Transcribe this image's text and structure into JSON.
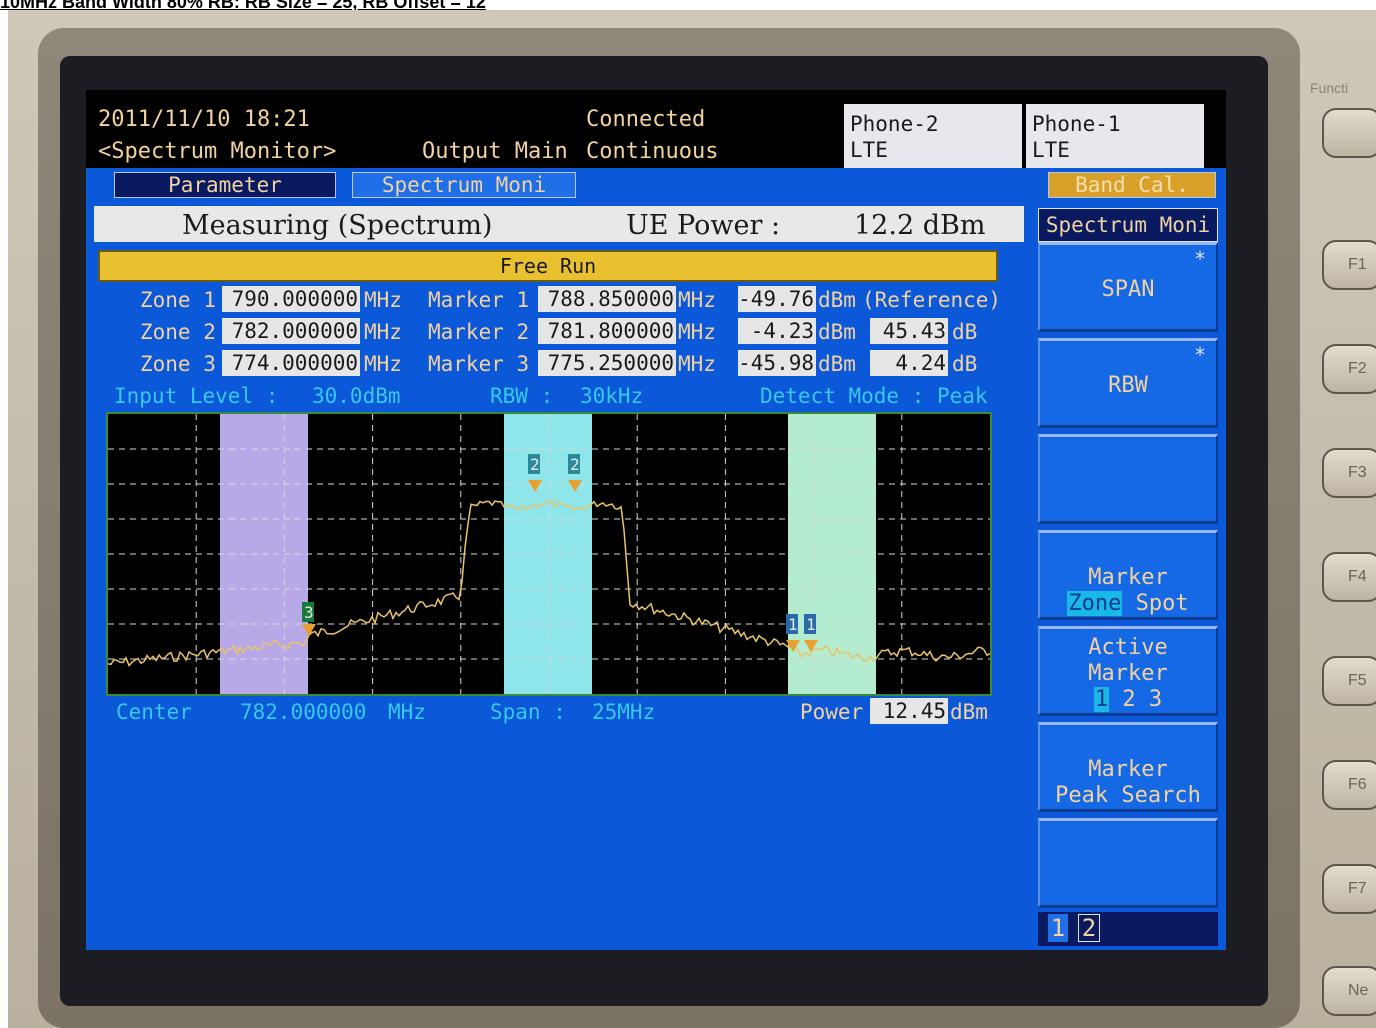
{
  "caption": "10MHz Band Width 80% RB: RB Size = 25, RB Offset = 12",
  "header": {
    "datetime": "2011/11/10 18:21",
    "screen_name": "<Spectrum Monitor>",
    "output": "Output Main",
    "conn_status": "Connected",
    "run_mode": "Continuous",
    "phone2": {
      "name": "Phone-2",
      "tech": "LTE"
    },
    "phone1": {
      "name": "Phone-1",
      "tech": "LTE"
    }
  },
  "tabs": {
    "parameter": "Parameter",
    "spectrum": "Spectrum Moni",
    "band_cal": "Band Cal."
  },
  "status": {
    "measuring": "Measuring (Spectrum)",
    "ue_power_label": "UE Power :",
    "ue_power_value": "12.2 dBm"
  },
  "trigger": "Free Run",
  "units": {
    "mhz": "MHz",
    "dbm": "dBm",
    "db": "dB"
  },
  "zones": [
    {
      "label": "Zone 1",
      "freq": "790.000000"
    },
    {
      "label": "Zone 2",
      "freq": "782.000000"
    },
    {
      "label": "Zone 3",
      "freq": "774.000000"
    }
  ],
  "markers": [
    {
      "label": "Marker 1",
      "freq": "788.850000",
      "level": "-49.76",
      "rel": "",
      "ref_note": "(Reference)"
    },
    {
      "label": "Marker 2",
      "freq": "781.800000",
      "level": "-4.23",
      "rel": "45.43"
    },
    {
      "label": "Marker 3",
      "freq": "775.250000",
      "level": "-45.98",
      "rel": "4.24"
    }
  ],
  "settings": {
    "input_level_label": "Input Level :",
    "input_level": "30.0dBm",
    "rbw_label": "RBW :",
    "rbw": "30kHz",
    "detect_label": "Detect Mode : Peak"
  },
  "footer": {
    "center_label": "Center",
    "center": "782.000000",
    "center_unit": "MHz",
    "span_label": "Span :",
    "span": "25MHz",
    "power_label": "Power",
    "power": "12.45",
    "power_unit": "dBm"
  },
  "graph": {
    "marker_tags": [
      "3",
      "2",
      "2",
      "1",
      "1"
    ]
  },
  "softkeys": {
    "header": "Spectrum Moni",
    "span": "SPAN",
    "rbw": "RBW",
    "star": "*",
    "marker": "Marker",
    "zone": "Zone",
    "spot": "Spot",
    "active": "Active",
    "m1": "1",
    "m2": "2",
    "m3": "3",
    "peak_search": "Peak Search",
    "page1": "1",
    "page2": "2"
  },
  "hard_keys": {
    "function": "Functi",
    "f1": "F1",
    "f2": "F2",
    "f3": "F3",
    "f4": "F4",
    "f5": "F5",
    "f6": "F6",
    "f7": "F7",
    "next": "Ne"
  },
  "colors": {
    "screen_bg": "#0b58d8",
    "trace": "#e8c46a",
    "zone3": "#b7a8e8",
    "zone2": "#8fe6ea",
    "zone1": "#b4ecd0"
  }
}
